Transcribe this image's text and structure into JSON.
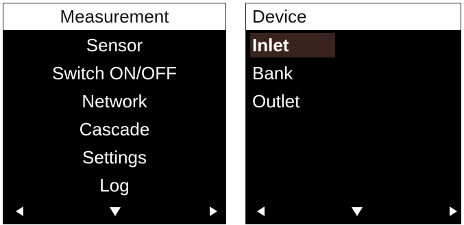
{
  "left_screen": {
    "title": "Measurement",
    "items": [
      {
        "label": "Sensor"
      },
      {
        "label": "Switch ON/OFF"
      },
      {
        "label": "Network"
      },
      {
        "label": "Cascade"
      },
      {
        "label": "Settings"
      },
      {
        "label": "Log"
      }
    ],
    "nav": {
      "left_icon": "triangle-left-icon",
      "down_icon": "triangle-down-icon",
      "right_icon": "triangle-right-icon"
    }
  },
  "right_screen": {
    "title": "Device",
    "items": [
      {
        "label": "Inlet",
        "selected": true
      },
      {
        "label": "Bank",
        "selected": false
      },
      {
        "label": "Outlet",
        "selected": false
      }
    ],
    "nav": {
      "left_icon": "triangle-left-icon",
      "down_icon": "triangle-down-icon",
      "right_icon": "triangle-right-icon"
    }
  },
  "colors": {
    "screen_background": "#000000",
    "title_background": "#ffffff",
    "title_text": "#111111",
    "item_text": "#ffffff",
    "selection_highlight": "#3a231e"
  }
}
